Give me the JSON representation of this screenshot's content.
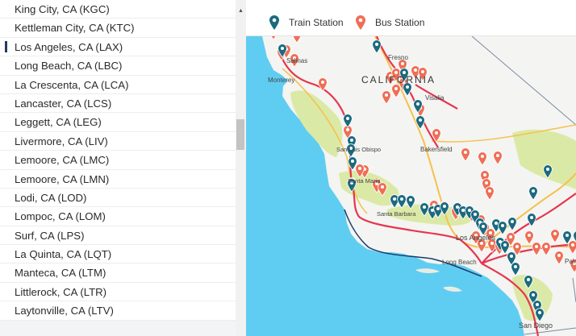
{
  "stations": [
    {
      "label": "King City, CA (KGC)"
    },
    {
      "label": "Kettleman City, CA (KTC)"
    },
    {
      "label": "Los Angeles, CA (LAX)",
      "selected": true
    },
    {
      "label": "Long Beach, CA (LBC)"
    },
    {
      "label": "La Crescenta, CA (LCA)"
    },
    {
      "label": "Lancaster, CA (LCS)"
    },
    {
      "label": "Leggett, CA (LEG)"
    },
    {
      "label": "Livermore, CA (LIV)"
    },
    {
      "label": "Lemoore, CA (LMC)"
    },
    {
      "label": "Lemoore, CA (LMN)"
    },
    {
      "label": "Lodi, CA (LOD)"
    },
    {
      "label": "Lompoc, CA (LOM)"
    },
    {
      "label": "Surf, CA (LPS)"
    },
    {
      "label": "La Quinta, CA (LQT)"
    },
    {
      "label": "Manteca, CA (LTM)"
    },
    {
      "label": "Littlerock, CA (LTR)"
    },
    {
      "label": "Laytonville, CA (LTV)"
    }
  ],
  "legend": {
    "train_label": "Train Station",
    "bus_label": "Bus Station",
    "train_color": "#1b6a80",
    "bus_color": "#ef6e55"
  },
  "map": {
    "labels": {
      "state": "CALIFORNIA",
      "fresno": "Fresno",
      "visalia": "Visalia",
      "monterey": "Monterey",
      "salinas": "Salinas",
      "bakersfield": "Bakersfield",
      "san_luis_obispo": "San Luis Obispo",
      "santa_maria": "Santa Maria",
      "santa_barbara": "Santa Barbara",
      "los_angeles": "Los Angeles",
      "long_beach": "Long Beach",
      "san_diego": "San Diego",
      "palm_springs": "Palm Springs"
    },
    "colors": {
      "ocean": "#5fcdf1",
      "land": "#f4f4f2",
      "park": "#dbe9a6",
      "route": "#e5364f",
      "road": "#f5c14d"
    },
    "icons": {
      "train_marker": "map-pin-teardrop",
      "bus_marker": "map-pin-teardrop"
    }
  }
}
